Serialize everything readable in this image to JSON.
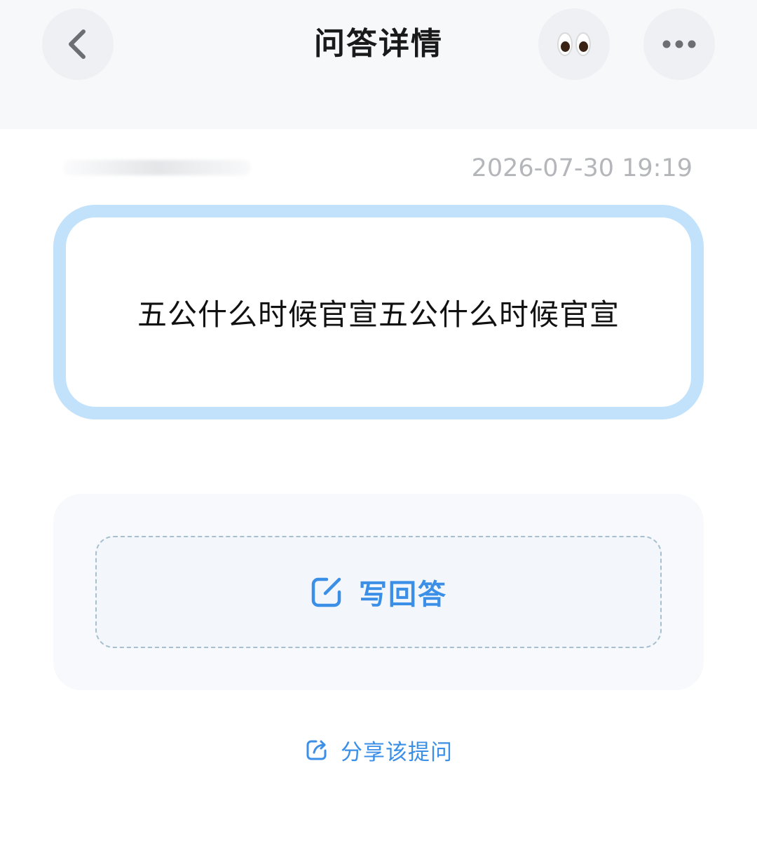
{
  "header": {
    "title": "问答详情"
  },
  "meta": {
    "timestamp": "2026-07-30 19:19"
  },
  "question": {
    "text": "五公什么时候官宣五公什么时候官宣"
  },
  "answer": {
    "write_label": "写回答"
  },
  "share": {
    "label": "分享该提问"
  },
  "colors": {
    "accent": "#3b8fe6",
    "card_border": "#c2e1fb",
    "header_bg": "#f7f8fa"
  },
  "icons": {
    "back": "chevron-left-icon",
    "watch": "eyes-icon",
    "more": "ellipsis-icon",
    "write": "edit-icon",
    "share": "share-icon"
  }
}
